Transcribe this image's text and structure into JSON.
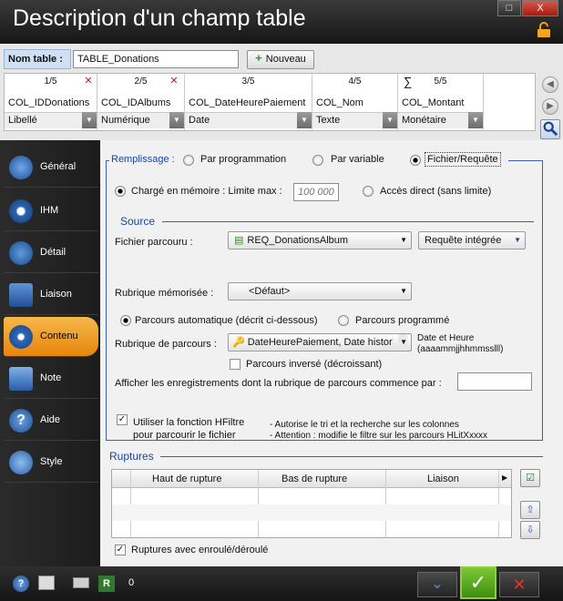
{
  "window": {
    "title": "Description d'un champ table",
    "close": "X",
    "maximize": "□"
  },
  "table": {
    "name_label": "Nom table :",
    "name_value": "TABLE_Donations",
    "new_button": "Nouveau",
    "columns": [
      {
        "num": "1/5",
        "name": "COL_IDDonations",
        "type": "Libellé"
      },
      {
        "num": "2/5",
        "name": "COL_IDAlbums",
        "type": "Numérique"
      },
      {
        "num": "3/5",
        "name": "COL_DateHeurePaiement",
        "type": "Date"
      },
      {
        "num": "4/5",
        "name": "COL_Nom",
        "type": "Texte"
      },
      {
        "num": "5/5",
        "name": "COL_Montant",
        "type": "Monétaire",
        "sigma": "∑"
      }
    ]
  },
  "sidebar": {
    "items": [
      {
        "label": "Général"
      },
      {
        "label": "IHM"
      },
      {
        "label": "Détail"
      },
      {
        "label": "Liaison"
      },
      {
        "label": "Contenu"
      },
      {
        "label": "Note"
      },
      {
        "label": "Aide"
      },
      {
        "label": "Style"
      }
    ],
    "active": "Contenu"
  },
  "main": {
    "fill_label": "Remplissage :",
    "fill_options": [
      "Par programmation",
      "Par variable",
      "Fichier/Requête"
    ],
    "fill_selected": "Fichier/Requête",
    "mem_loaded": "Chargé en mémoire : Limite max :",
    "mem_max_placeholder": "100 000",
    "direct_access": "Accès direct (sans limite)",
    "source_title": "Source",
    "browsed_file_label": "Fichier parcouru :",
    "browsed_file_value": "REQ_DonationsAlbum",
    "query_button": "Requête intégrée",
    "memorized_label": "Rubrique mémorisée :",
    "memorized_value": "<Défaut>",
    "auto_browse": "Parcours automatique (décrit ci-dessous)",
    "prog_browse": "Parcours programmé",
    "browse_key_label": "Rubrique de parcours :",
    "browse_key_value": "DateHeurePaiement, Date histor",
    "date_hint_1": "Date et Heure",
    "date_hint_2": "(aaaammjjhhmmsslll)",
    "reverse": "Parcours inversé (décroissant)",
    "start_label": "Afficher les enregistrements dont la rubrique de parcours commence par :",
    "start_value": "",
    "hfilter_1": "Utiliser la fonction HFiltre",
    "hfilter_2": "pour parcourir le fichier",
    "note_1": "- Autorise le tri et la recherche sur les colonnes",
    "note_2": "- Attention : modifie le filtre sur les parcours HLitXxxxx",
    "breaks_title": "Ruptures",
    "breaks_headers": [
      "Haut de rupture",
      "Bas de rupture",
      "Liaison"
    ],
    "breaks_rows": [],
    "breaks_check": "Ruptures avec enroulé/déroulé"
  },
  "bottom": {
    "counter": "0"
  },
  "colors": {
    "accent": "#f0a02a",
    "border_blue": "#3a5fb0",
    "label_blue": "#1a46a0"
  }
}
